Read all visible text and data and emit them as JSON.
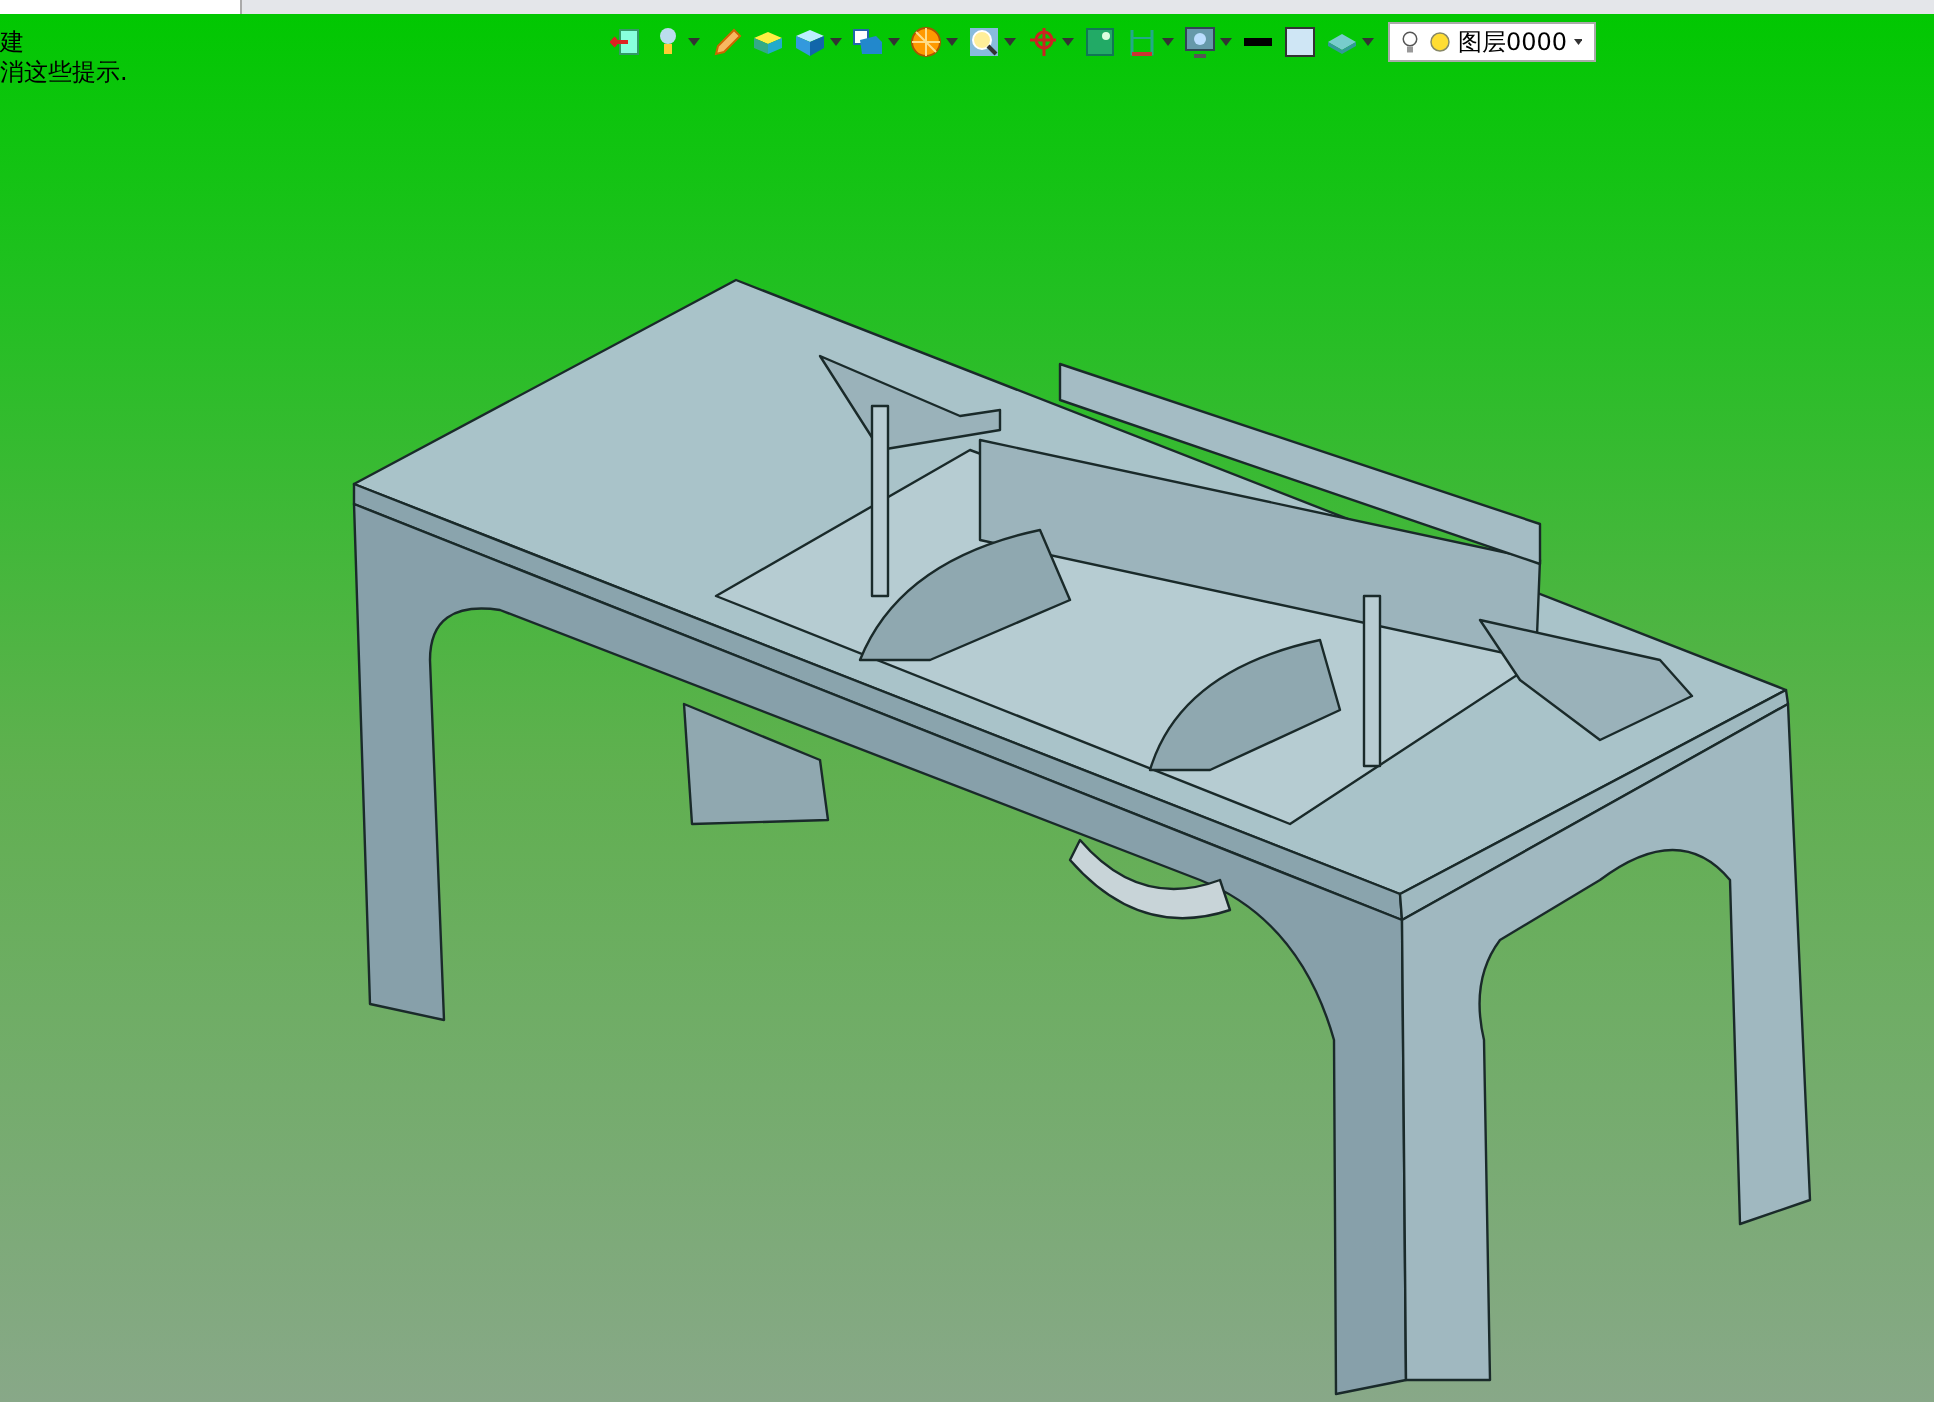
{
  "hints": [
    "建",
    "消这些提示."
  ],
  "layer_dropdown": {
    "value": "图层0000"
  }
}
